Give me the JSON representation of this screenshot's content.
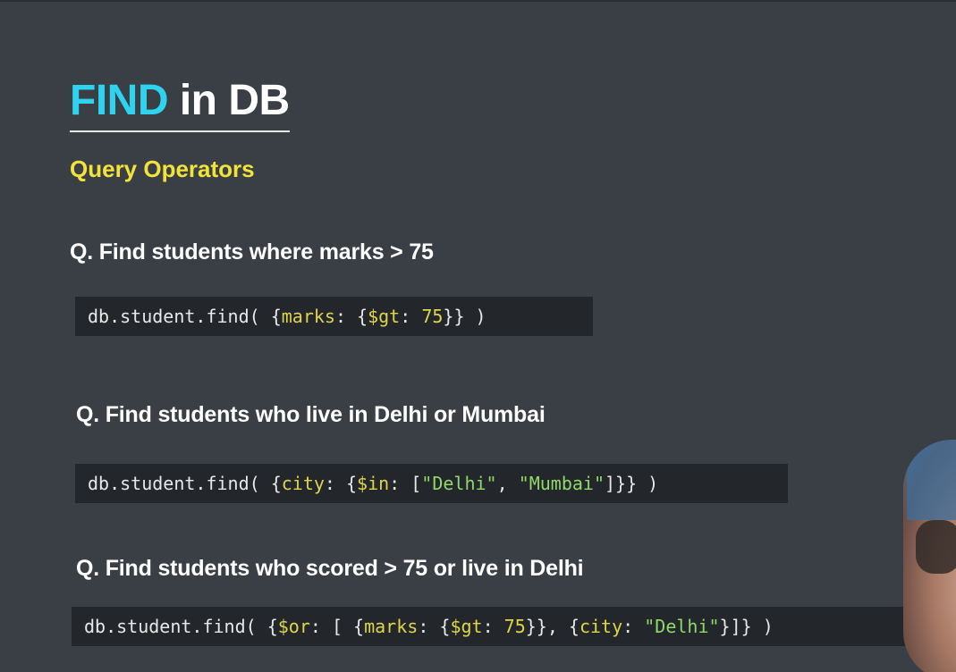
{
  "slide": {
    "title_keyword": "FIND",
    "title_rest": " in DB",
    "subtitle": "Query Operators"
  },
  "examples": [
    {
      "question": "Q. Find students where marks > 75",
      "code": [
        {
          "t": "db.student.find( {",
          "c": "plain"
        },
        {
          "t": "marks",
          "c": "key"
        },
        {
          "t": ": {",
          "c": "plain"
        },
        {
          "t": "$gt",
          "c": "key"
        },
        {
          "t": ": ",
          "c": "plain"
        },
        {
          "t": "75",
          "c": "key"
        },
        {
          "t": "}} )",
          "c": "plain"
        }
      ]
    },
    {
      "question": "Q. Find students who live in Delhi or Mumbai",
      "code": [
        {
          "t": "db.student.find( {",
          "c": "plain"
        },
        {
          "t": "city",
          "c": "key"
        },
        {
          "t": ": {",
          "c": "plain"
        },
        {
          "t": "$in",
          "c": "key"
        },
        {
          "t": ": [",
          "c": "plain"
        },
        {
          "t": "\"Delhi\"",
          "c": "str"
        },
        {
          "t": ", ",
          "c": "plain"
        },
        {
          "t": "\"Mumbai\"",
          "c": "str"
        },
        {
          "t": "]}} )",
          "c": "plain"
        }
      ]
    },
    {
      "question": "Q. Find students who scored > 75 or live in Delhi",
      "code": [
        {
          "t": "db.student.find( {",
          "c": "plain"
        },
        {
          "t": "$or",
          "c": "key"
        },
        {
          "t": ": [ {",
          "c": "plain"
        },
        {
          "t": "marks",
          "c": "key"
        },
        {
          "t": ": {",
          "c": "plain"
        },
        {
          "t": "$gt",
          "c": "key"
        },
        {
          "t": ": ",
          "c": "plain"
        },
        {
          "t": "75",
          "c": "key"
        },
        {
          "t": "}}, {",
          "c": "plain"
        },
        {
          "t": "city",
          "c": "key"
        },
        {
          "t": ": ",
          "c": "plain"
        },
        {
          "t": "\"Delhi\"",
          "c": "str"
        },
        {
          "t": "}]} )",
          "c": "plain"
        }
      ]
    }
  ],
  "colors": {
    "background": "#3a3f45",
    "title_keyword": "#2ed3f0",
    "subtitle": "#f2e33a",
    "code_background": "#23272b",
    "code_key": "#e0d54a",
    "code_string": "#8fd86a"
  }
}
